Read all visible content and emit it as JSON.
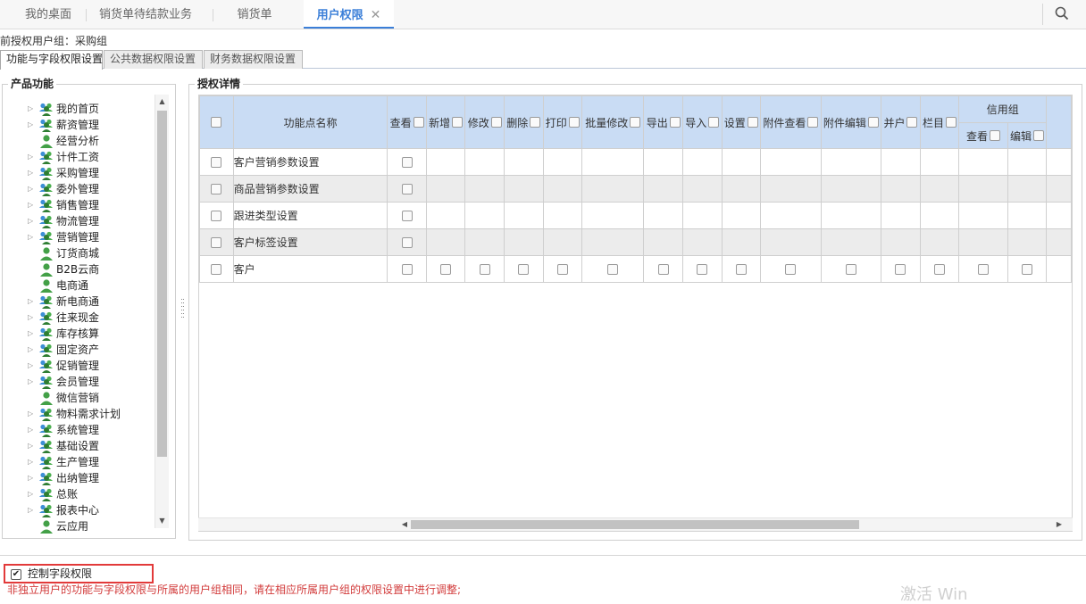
{
  "top_tabs": [
    {
      "label": "我的桌面"
    },
    {
      "label": "销货单待结款业务"
    },
    {
      "label": "销货单"
    },
    {
      "label": "用户权限",
      "close": "✕"
    }
  ],
  "group_line": "前授权用户组：采购组",
  "sub_tabs": [
    "功能与字段权限设置",
    "公共数据权限设置",
    "财务数据权限设置"
  ],
  "left_panel": {
    "title": "产品功能"
  },
  "tree": [
    {
      "label": "我的首页",
      "expandable": true
    },
    {
      "label": "薪资管理",
      "expandable": true
    },
    {
      "label": "经营分析",
      "expandable": false
    },
    {
      "label": "计件工资",
      "expandable": true
    },
    {
      "label": "采购管理",
      "expandable": true
    },
    {
      "label": "委外管理",
      "expandable": true
    },
    {
      "label": "销售管理",
      "expandable": true
    },
    {
      "label": "物流管理",
      "expandable": true
    },
    {
      "label": "营销管理",
      "expandable": true
    },
    {
      "label": "订货商城",
      "expandable": false
    },
    {
      "label": "B2B云商",
      "expandable": false
    },
    {
      "label": "电商通",
      "expandable": false
    },
    {
      "label": "新电商通",
      "expandable": true
    },
    {
      "label": "往来现金",
      "expandable": true
    },
    {
      "label": "库存核算",
      "expandable": true
    },
    {
      "label": "固定资产",
      "expandable": true
    },
    {
      "label": "促销管理",
      "expandable": true
    },
    {
      "label": "会员管理",
      "expandable": true
    },
    {
      "label": "微信营销",
      "expandable": false
    },
    {
      "label": "物料需求计划",
      "expandable": true
    },
    {
      "label": "系统管理",
      "expandable": true
    },
    {
      "label": "基础设置",
      "expandable": true
    },
    {
      "label": "生产管理",
      "expandable": true
    },
    {
      "label": "出纳管理",
      "expandable": true
    },
    {
      "label": "总账",
      "expandable": true
    },
    {
      "label": "报表中心",
      "expandable": true
    },
    {
      "label": "云应用",
      "expandable": false
    }
  ],
  "right_panel": {
    "title": "授权详情"
  },
  "grid": {
    "name_header": "功能点名称",
    "columns": [
      "查看",
      "新增",
      "修改",
      "删除",
      "打印",
      "批量修改",
      "导出",
      "导入",
      "设置",
      "附件查看",
      "附件编辑",
      "并户",
      "栏目"
    ],
    "group_header": "信用组",
    "group_sub": [
      "查看",
      "编辑"
    ],
    "rows": [
      {
        "name": "客户营销参数设置",
        "type": "view-only"
      },
      {
        "name": "商品营销参数设置",
        "type": "view-only"
      },
      {
        "name": "跟进类型设置",
        "type": "view-only"
      },
      {
        "name": "客户标签设置",
        "type": "view-only"
      },
      {
        "name": "客户",
        "type": "full"
      }
    ]
  },
  "control": {
    "label": "控制字段权限",
    "checked": true
  },
  "note": "非独立用户的功能与字段权限与所属的用户组相同，请在相应所属用户组的权限设置中进行调整;",
  "watermark": "激活 Win",
  "colors": {
    "accent": "#3b7fd8",
    "header_bg": "#c9dcf4",
    "note": "#d23b3b",
    "highlight_border": "#e23a3a"
  },
  "icons": {
    "search": "search-icon",
    "tree_node": "users-group-icon",
    "tree_leaf": "user-icon"
  }
}
